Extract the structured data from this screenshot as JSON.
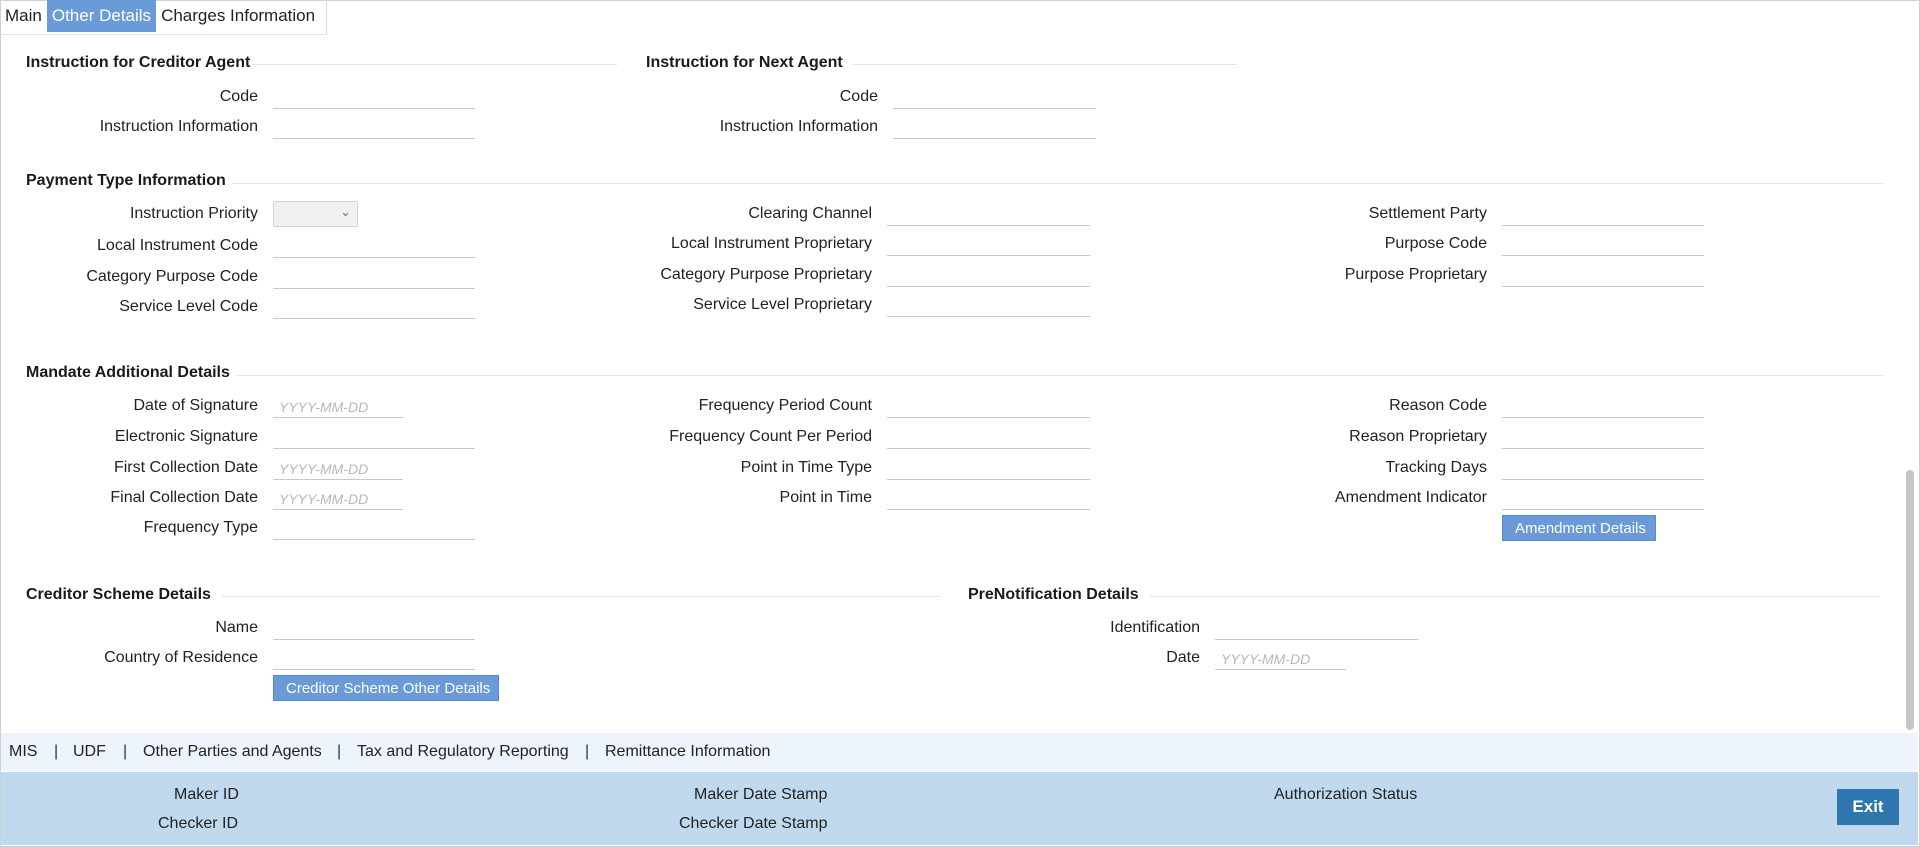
{
  "tabs": [
    "Main",
    "Other Details",
    "Charges Information"
  ],
  "creditor_agent": {
    "title": "Instruction for Creditor Agent",
    "code_label": "Code",
    "info_label": "Instruction Information"
  },
  "next_agent": {
    "title": "Instruction for Next Agent",
    "code_label": "Code",
    "info_label": "Instruction Information"
  },
  "payment_type": {
    "title": "Payment Type Information",
    "col1": [
      "Instruction Priority",
      "Local Instrument Code",
      "Category Purpose Code",
      "Service Level Code"
    ],
    "col2": [
      "Clearing Channel",
      "Local Instrument Proprietary",
      "Category Purpose Proprietary",
      "Service Level Proprietary"
    ],
    "col3": [
      "Settlement Party",
      "Purpose Code",
      "Purpose Proprietary"
    ]
  },
  "mandate": {
    "title": "Mandate Additional Details",
    "col1": [
      "Date of Signature",
      "Electronic Signature",
      "First Collection Date",
      "Final Collection Date",
      "Frequency Type"
    ],
    "col2": [
      "Frequency Period Count",
      "Frequency Count Per Period",
      "Point in Time Type",
      "Point in Time"
    ],
    "col3": [
      "Reason Code",
      "Reason Proprietary",
      "Tracking Days",
      "Amendment Indicator"
    ],
    "date_placeholder": "YYYY-MM-DD",
    "amendment_button": "Amendment Details"
  },
  "creditor_scheme": {
    "title": "Creditor Scheme Details",
    "name_label": "Name",
    "country_label": "Country of Residence",
    "button": "Creditor Scheme Other Details"
  },
  "prenotification": {
    "title": "PreNotification Details",
    "id_label": "Identification",
    "date_label": "Date",
    "date_placeholder": "YYYY-MM-DD"
  },
  "links": [
    "MIS",
    "UDF",
    "Other Parties and Agents",
    "Tax and Regulatory Reporting",
    "Remittance Information"
  ],
  "link_separator": "|",
  "footer": {
    "maker_id": "Maker ID",
    "checker_id": "Checker ID",
    "maker_date": "Maker Date Stamp",
    "checker_date": "Checker Date Stamp",
    "auth_status": "Authorization Status",
    "exit": "Exit"
  },
  "colors": {
    "accent": "#6a9ad8",
    "footer_bg": "#c0d9ee",
    "exit_bg": "#2f75ae",
    "linkbar_bg": "#eef4fb"
  }
}
